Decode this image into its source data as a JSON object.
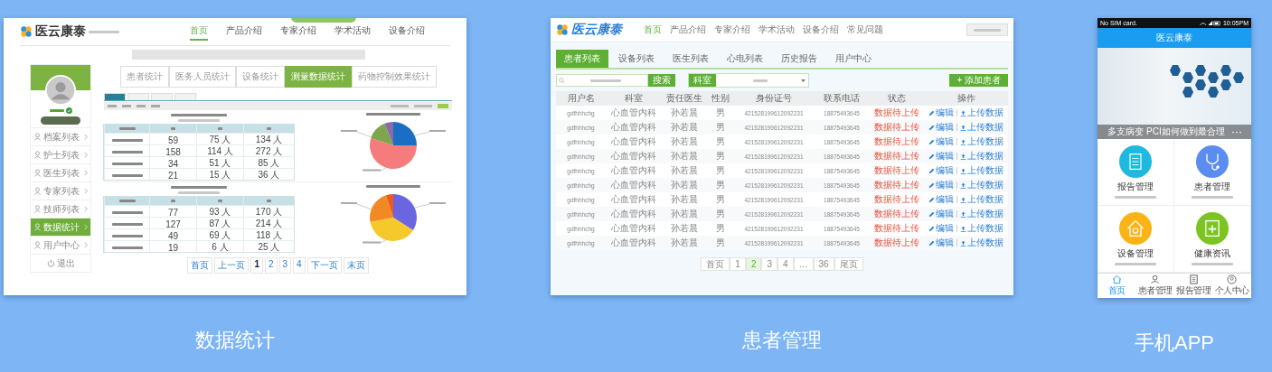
{
  "stats_screen": {
    "caption": "数据统计",
    "logo": "医云康泰",
    "nav": [
      {
        "label": "首页",
        "selected": true
      },
      {
        "label": "产品介绍",
        "selected": false
      },
      {
        "label": "专家介绍",
        "selected": false
      },
      {
        "label": "学术活动",
        "selected": false
      },
      {
        "label": "设备介绍",
        "selected": false
      }
    ],
    "tabs": [
      {
        "label": "患者统计",
        "selected": false
      },
      {
        "label": "医务人员统计",
        "selected": false
      },
      {
        "label": "设备统计",
        "selected": false
      },
      {
        "label": "测量数据统计",
        "selected": true
      },
      {
        "label": "药物控制效果统计",
        "selected": false
      }
    ],
    "sidebar": [
      {
        "label": "档案列表",
        "selected": false
      },
      {
        "label": "护士列表",
        "selected": false
      },
      {
        "label": "医生列表",
        "selected": false
      },
      {
        "label": "专家列表",
        "selected": false
      },
      {
        "label": "技师列表",
        "selected": false
      },
      {
        "label": "数据统计",
        "selected": true
      },
      {
        "label": "用户中心",
        "selected": false
      }
    ],
    "logout": "退出",
    "tables": [
      {
        "rows": [
          [
            "59",
            "75 人",
            "134 人"
          ],
          [
            "158",
            "114 人",
            "272 人"
          ],
          [
            "34",
            "51 人",
            "85 人"
          ],
          [
            "21",
            "15 人",
            "36 人"
          ]
        ]
      },
      {
        "rows": [
          [
            "77",
            "93 人",
            "170 人"
          ],
          [
            "127",
            "87 人",
            "214 人"
          ],
          [
            "49",
            "69 人",
            "118 人"
          ],
          [
            "19",
            "6 人",
            "25 人"
          ]
        ]
      }
    ],
    "pagination": [
      {
        "label": "首页",
        "selected": false
      },
      {
        "label": "上一页",
        "selected": false
      },
      {
        "label": "1",
        "selected": true
      },
      {
        "label": "2",
        "selected": false
      },
      {
        "label": "3",
        "selected": false
      },
      {
        "label": "4",
        "selected": false
      },
      {
        "label": "下一页",
        "selected": false
      },
      {
        "label": "末页",
        "selected": false
      }
    ]
  },
  "patients_screen": {
    "caption": "患者管理",
    "logo": "医云康泰",
    "nav": [
      {
        "label": "首页",
        "selected": true
      },
      {
        "label": "产品介绍",
        "selected": false
      },
      {
        "label": "专家介绍",
        "selected": false
      },
      {
        "label": "学术活动",
        "selected": false
      },
      {
        "label": "设备介绍",
        "selected": false
      },
      {
        "label": "常见问题",
        "selected": false
      }
    ],
    "tabs": [
      {
        "label": "患者列表",
        "selected": true
      },
      {
        "label": "设备列表",
        "selected": false
      },
      {
        "label": "医生列表",
        "selected": false
      },
      {
        "label": "心电列表",
        "selected": false
      },
      {
        "label": "历史报告",
        "selected": false
      },
      {
        "label": "用户中心",
        "selected": false
      }
    ],
    "search_button": "搜索",
    "department_label": "科室",
    "add_button": "+ 添加患者",
    "columns": [
      "用户名",
      "科室",
      "责任医生",
      "性别",
      "身份证号",
      "联系电话",
      "状态",
      "操作"
    ],
    "rows": [
      {
        "cells": [
          "gdfhhhchg",
          "心血管内科",
          "孙若晨",
          "男",
          "421528199612092231",
          "18875493645",
          "数据待上传"
        ],
        "actions": [
          "编辑",
          "上传数据"
        ]
      },
      {
        "cells": [
          "gdfhhhchg",
          "心血管内科",
          "孙若晨",
          "男",
          "421528199612092231",
          "18875493645",
          "数据待上传"
        ],
        "actions": [
          "编辑",
          "上传数据"
        ]
      },
      {
        "cells": [
          "gdfhhhchg",
          "心血管内科",
          "孙若晨",
          "男",
          "421528199612092231",
          "18875493645",
          "数据待上传"
        ],
        "actions": [
          "编辑",
          "上传数据"
        ]
      },
      {
        "cells": [
          "gdfhhhchg",
          "心血管内科",
          "孙若晨",
          "男",
          "421528199612092231",
          "18875493645",
          "数据待上传"
        ],
        "actions": [
          "编辑",
          "上传数据"
        ]
      },
      {
        "cells": [
          "gdfhhhchg",
          "心血管内科",
          "孙若晨",
          "男",
          "421528199612092231",
          "18875493645",
          "数据待上传"
        ],
        "actions": [
          "编辑",
          "上传数据"
        ]
      },
      {
        "cells": [
          "gdfhhhchg",
          "心血管内科",
          "孙若晨",
          "男",
          "421528199612092231",
          "18875493645",
          "数据待上传"
        ],
        "actions": [
          "编辑",
          "上传数据"
        ]
      },
      {
        "cells": [
          "gdfhhhchg",
          "心血管内科",
          "孙若晨",
          "男",
          "421528199612092231",
          "18875493645",
          "数据待上传"
        ],
        "actions": [
          "编辑",
          "上传数据"
        ]
      },
      {
        "cells": [
          "gdfhhhchg",
          "心血管内科",
          "孙若晨",
          "男",
          "421528199612092231",
          "18875493645",
          "数据待上传"
        ],
        "actions": [
          "编辑",
          "上传数据"
        ]
      },
      {
        "cells": [
          "gdfhhhchg",
          "心血管内科",
          "孙若晨",
          "男",
          "421528199612092231",
          "18875493645",
          "数据待上传"
        ],
        "actions": [
          "编辑",
          "上传数据"
        ]
      },
      {
        "cells": [
          "gdfhhhchg",
          "心血管内科",
          "孙若晨",
          "男",
          "421528199612092231",
          "18875493645",
          "数据待上传"
        ],
        "actions": [
          "编辑",
          "上传数据"
        ]
      }
    ],
    "pagination": [
      {
        "label": "首页",
        "selected": false
      },
      {
        "label": "1",
        "selected": false
      },
      {
        "label": "2",
        "selected": true
      },
      {
        "label": "3",
        "selected": false
      },
      {
        "label": "4",
        "selected": false
      },
      {
        "label": "…",
        "selected": false
      },
      {
        "label": "36",
        "selected": false
      },
      {
        "label": "尾页",
        "selected": false
      }
    ]
  },
  "mobile_screen": {
    "caption": "手机APP",
    "carrier": "No SIM card.",
    "time": "10:05PM",
    "title": "医云康泰",
    "banner_caption": "多支病变 PCI如何做到最合理",
    "tiles": [
      {
        "kind": "report",
        "label": "报告管理",
        "color": "#1fb8e0"
      },
      {
        "kind": "patient",
        "label": "患者管理",
        "color": "#5b8cf0"
      },
      {
        "kind": "device",
        "label": "设备管理",
        "color": "#fbb316"
      },
      {
        "kind": "news",
        "label": "健康资讯",
        "color": "#7cc420"
      }
    ],
    "tab_bar": [
      {
        "kind": "home",
        "label": "首页",
        "selected": true
      },
      {
        "kind": "patient",
        "label": "患者管理",
        "selected": false
      },
      {
        "kind": "report",
        "label": "报告管理",
        "selected": false
      },
      {
        "kind": "profile",
        "label": "个人中心",
        "selected": false
      }
    ]
  }
}
